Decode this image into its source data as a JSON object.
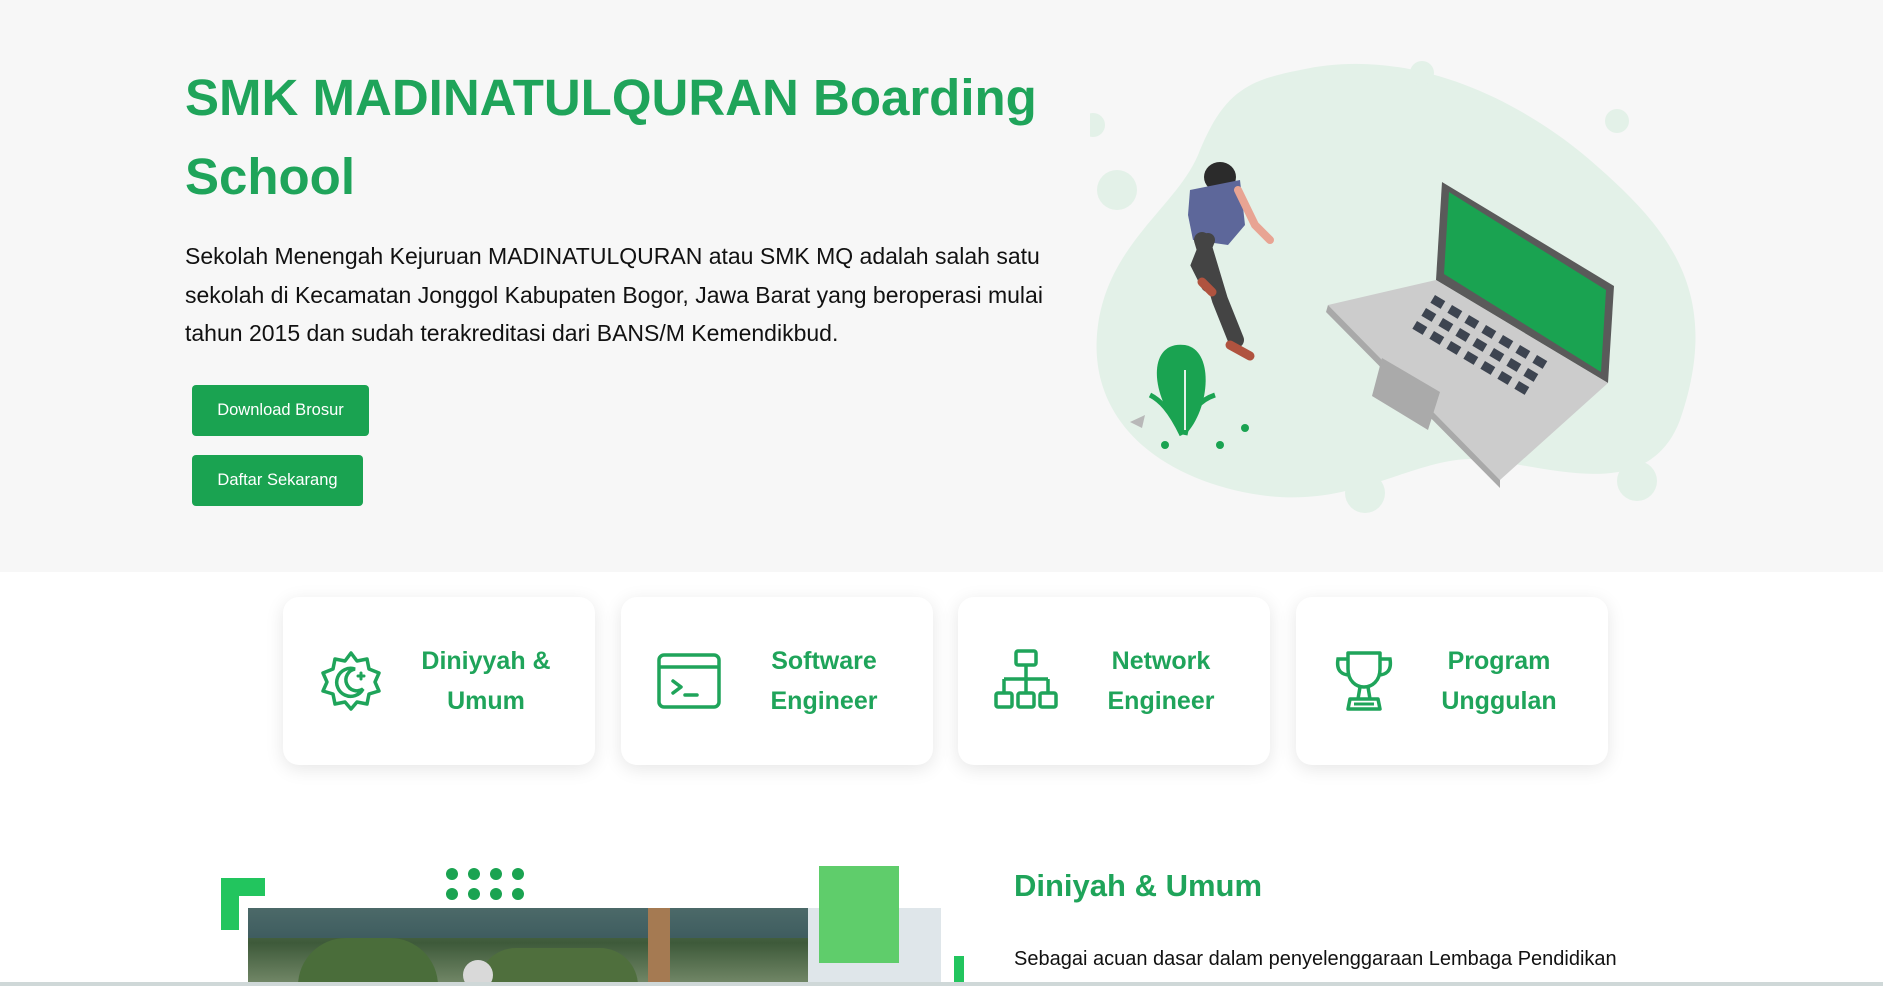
{
  "hero": {
    "title": "SMK MADINATULQURAN Boarding School",
    "description": "Sekolah Menengah Kejuruan MADINATULQURAN atau SMK MQ adalah salah satu sekolah di Kecamatan Jonggol Kabupaten Bogor, Jawa Barat yang beroperasi mulai tahun 2015 dan sudah terakreditasi dari BANS/M Kemendikbud.",
    "buttons": {
      "brochure": "Download Brosur",
      "register": "Daftar Sekarang"
    },
    "illustration_icon": "person-walking-laptop-illustration"
  },
  "features": [
    {
      "label": "Diniyyah & Umum",
      "icon": "moon-star-badge-icon"
    },
    {
      "label": "Software Engineer",
      "icon": "terminal-icon"
    },
    {
      "label": "Network Engineer",
      "icon": "network-hierarchy-icon"
    },
    {
      "label": "Program Unggulan",
      "icon": "trophy-icon"
    }
  ],
  "section": {
    "title": "Diniyah & Umum",
    "text": "Sebagai acuan dasar dalam penyelenggaraan Lembaga Pendidikan"
  },
  "colors": {
    "brand_green": "#1fa45a",
    "button_green": "#1aa351",
    "hero_bg": "#f7f7f7",
    "blob": "#e3f1e8"
  }
}
